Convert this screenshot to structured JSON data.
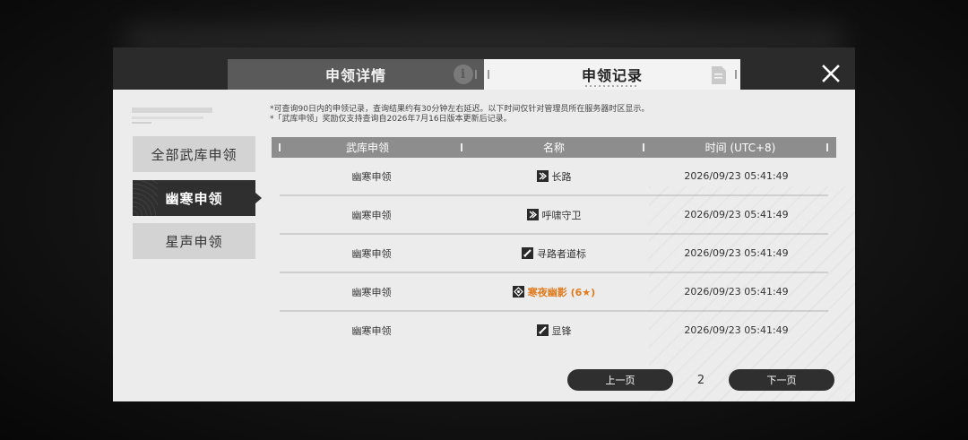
{
  "header": {
    "tab_details_label": "申领详情",
    "tab_records_label": "申领记录"
  },
  "sidebar": {
    "items": [
      {
        "label": "全部武库申领",
        "active": false
      },
      {
        "label": "幽寒申领",
        "active": true
      },
      {
        "label": "星声申领",
        "active": false
      }
    ]
  },
  "notes": {
    "line1": "*可查询90日内的申领记录，查询结果约有30分钟左右延迟。以下时间仅针对管理员所在服务器时区显示。",
    "line2": "*「武库申领」奖励仅支持查询自2026年7月16日版本更新后记录。"
  },
  "table": {
    "headers": [
      "武库申领",
      "名称",
      "时间 (UTC+8)"
    ],
    "rows": [
      {
        "type": "幽寒申领",
        "name": "长路",
        "icon": "weapon-arrow-icon",
        "time": "2026/09/23 05:41:49",
        "highlight": false
      },
      {
        "type": "幽寒申领",
        "name": "呼啸守卫",
        "icon": "weapon-arrow-icon",
        "time": "2026/09/23 05:41:49",
        "highlight": false
      },
      {
        "type": "幽寒申领",
        "name": "寻路者道标",
        "icon": "weapon-blade-icon",
        "time": "2026/09/23 05:41:49",
        "highlight": false
      },
      {
        "type": "幽寒申领",
        "name": "寒夜幽影 (6★)",
        "icon": "weapon-diamond-icon",
        "time": "2026/09/23 05:41:49",
        "highlight": true,
        "highlight_color": "#e07b1f"
      },
      {
        "type": "幽寒申领",
        "name": "显锋",
        "icon": "weapon-blade-icon",
        "time": "2026/09/23 05:41:49",
        "highlight": false
      }
    ]
  },
  "pager": {
    "prev_label": "上一页",
    "page": "2",
    "next_label": "下一页"
  },
  "colors": {
    "header_bg": "#2b2b2b",
    "panel_bg": "#ececec",
    "accent_gold": "#e07b1f",
    "button_dark": "#2f2f2f"
  }
}
